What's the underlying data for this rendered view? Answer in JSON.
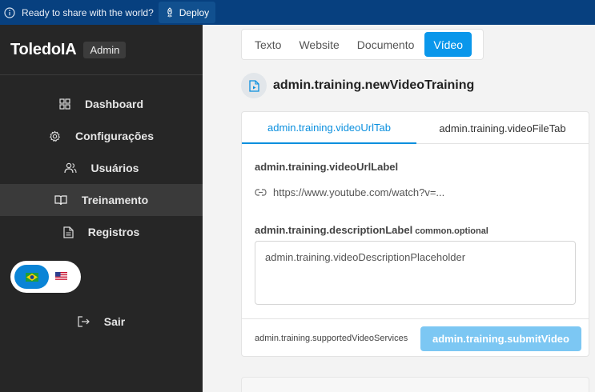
{
  "banner": {
    "text": "Ready to share with the world?",
    "deploy_label": "Deploy"
  },
  "sidebar": {
    "brand": "ToledoIA",
    "badge": "Admin",
    "items": [
      {
        "label": "Dashboard",
        "icon": "dashboard-icon"
      },
      {
        "label": "Configurações",
        "icon": "gear-icon"
      },
      {
        "label": "Usuários",
        "icon": "users-icon"
      },
      {
        "label": "Treinamento",
        "icon": "book-icon",
        "active": true
      },
      {
        "label": "Registros",
        "icon": "document-icon"
      }
    ],
    "logout": "Sair"
  },
  "type_tabs": [
    "Texto",
    "Website",
    "Documento",
    "Vídeo"
  ],
  "page_title": "admin.training.newVideoTraining",
  "card": {
    "tabs": [
      "admin.training.videoUrlTab",
      "admin.training.videoFileTab"
    ],
    "url_label": "admin.training.videoUrlLabel",
    "url_placeholder": "https://www.youtube.com/watch?v=...",
    "description_label": "admin.training.descriptionLabel",
    "optional": "common.optional",
    "description_placeholder": "admin.training.videoDescriptionPlaceholder",
    "supported": "admin.training.supportedVideoServices",
    "submit": "admin.training.submitVideo"
  },
  "colors": {
    "accent": "#0a97eb",
    "sidebar": "#262626",
    "banner": "#07407f"
  }
}
